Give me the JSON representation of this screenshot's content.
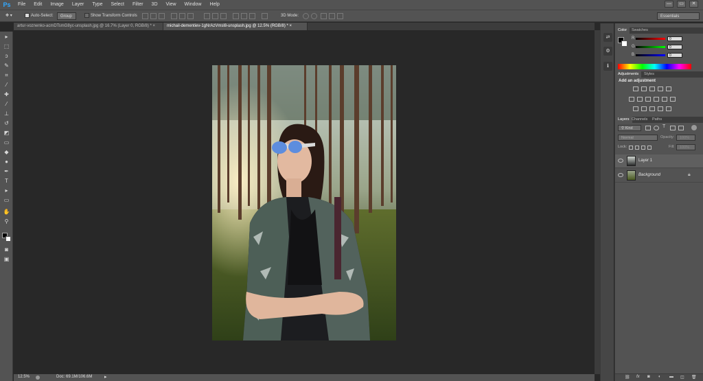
{
  "app": {
    "logo": "Ps"
  },
  "menu": [
    "File",
    "Edit",
    "Image",
    "Layer",
    "Type",
    "Select",
    "Filter",
    "3D",
    "View",
    "Window",
    "Help"
  ],
  "window_controls": [
    "—",
    "▭",
    "✕"
  ],
  "options": {
    "auto_select_label": "Auto-Select:",
    "auto_select_value": "Group",
    "transform_label": "Show Transform Controls",
    "mode_3d_label": "3D Mode:",
    "workspace": "Essentials"
  },
  "tabs": [
    {
      "label": "artur-voznenko-acmDTsmG8yc-unsplash.jpg @ 16.7% (Layer 0, RGB/8) *",
      "close": "×"
    },
    {
      "label": "michail-dementiev-1gNrAzVmsl8-unsplash.jpg @ 12.5% (RGB/8) *",
      "close": "×"
    }
  ],
  "status": {
    "zoom": "12.5%",
    "doc": "Doc: 69.1M/106.6M"
  },
  "color_panel": {
    "tabs": [
      "Color",
      "Swatches"
    ],
    "channels": [
      "R",
      "G",
      "B"
    ],
    "values": [
      "0",
      "0",
      "0"
    ]
  },
  "adjustments_panel": {
    "tabs": [
      "Adjustments",
      "Styles"
    ],
    "heading": "Add an adjustment"
  },
  "layers_panel": {
    "tabs": [
      "Layers",
      "Channels",
      "Paths"
    ],
    "kind_label": "Kind",
    "blend_mode": "Normal",
    "opacity_label": "Opacity:",
    "opacity_value": "100%",
    "lock_label": "Lock:",
    "fill_label": "Fill:",
    "fill_value": "100%",
    "layers": [
      {
        "name": "Layer 1"
      },
      {
        "name": "Background"
      }
    ]
  },
  "colors": {
    "accent": "#31a8ff",
    "ui": "#535353",
    "canvas": "#282828"
  }
}
